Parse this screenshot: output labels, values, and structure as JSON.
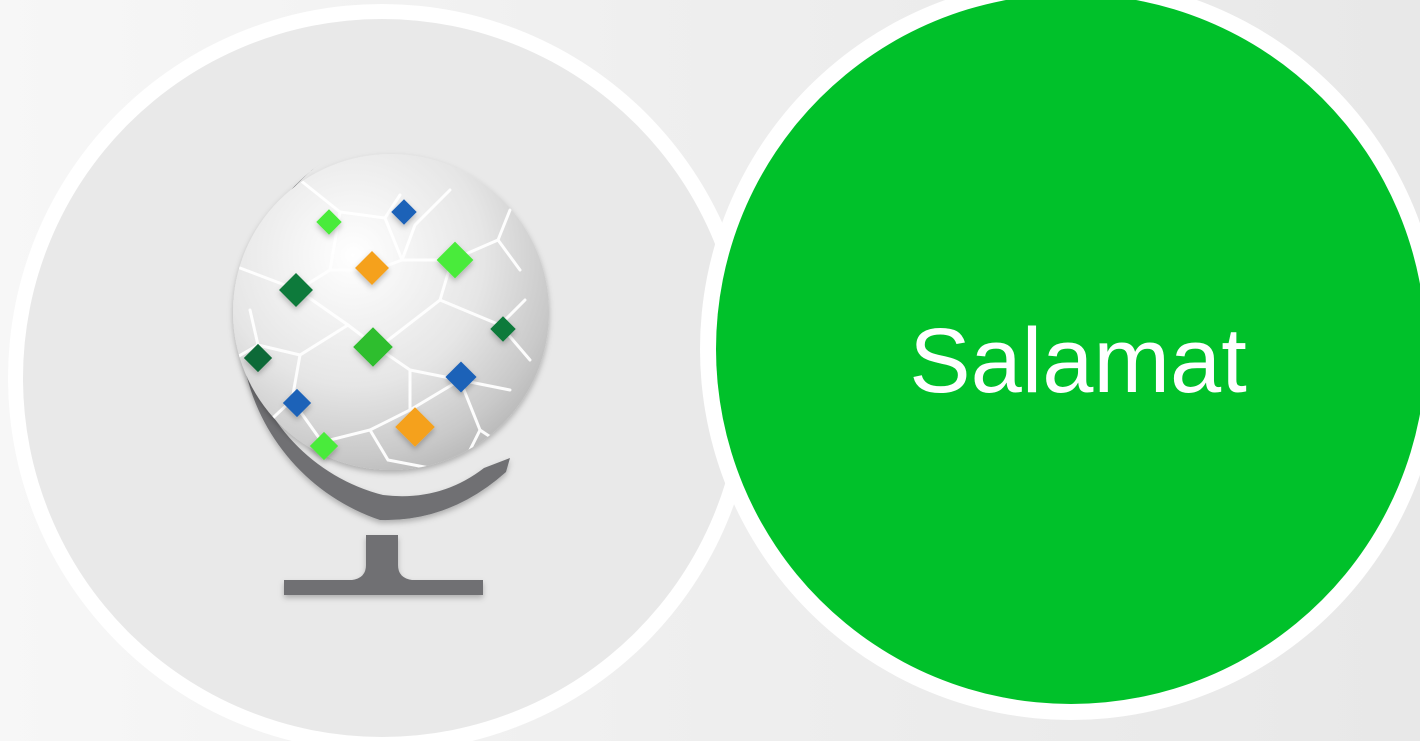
{
  "slide": {
    "title": "Salamat",
    "colors": {
      "background": "#efefef",
      "accent_green": "#00c12a",
      "ring_white": "#ffffff",
      "globe_stand_gray": "#6f7073"
    },
    "icon": "globe-icon"
  }
}
